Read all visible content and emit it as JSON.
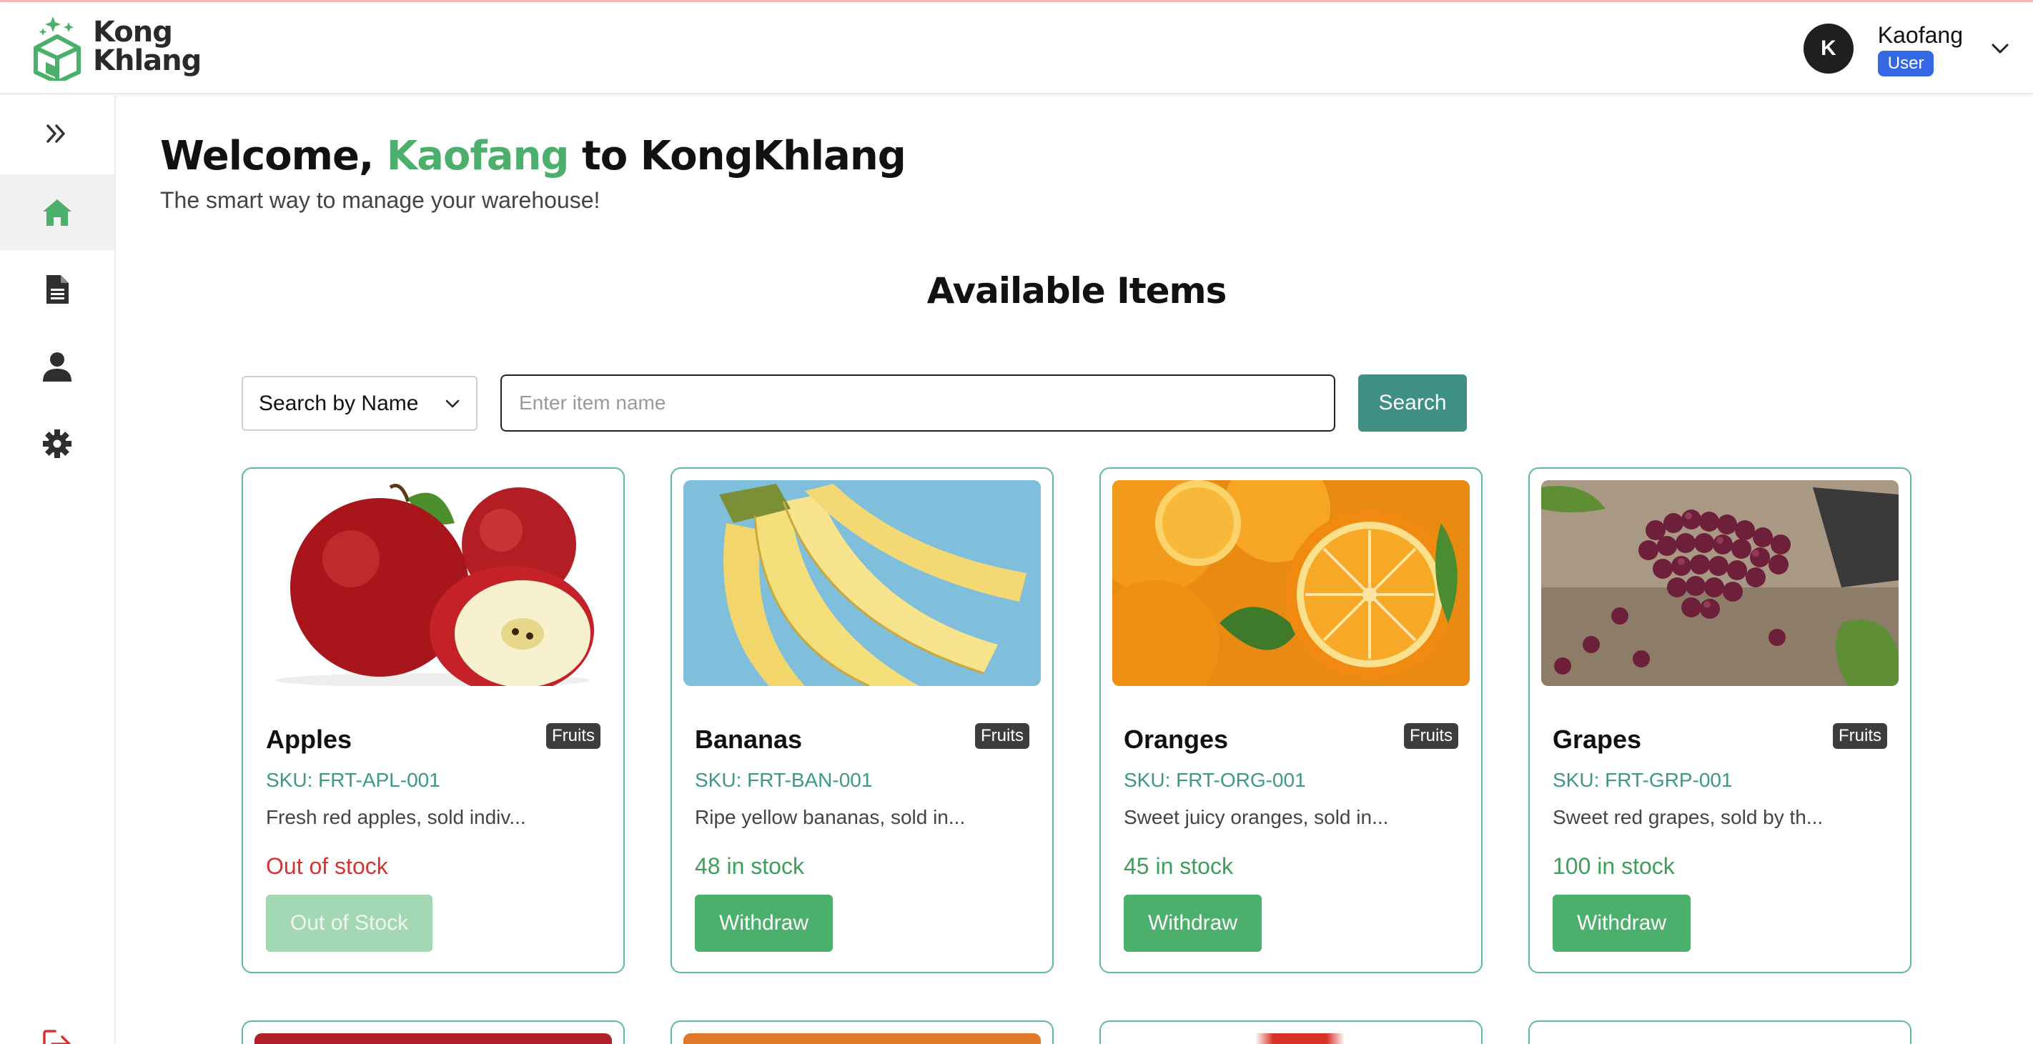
{
  "app": {
    "brand_line1": "Kong",
    "brand_line2": "Khlang"
  },
  "user": {
    "initial": "K",
    "name": "Kaofang",
    "role": "User"
  },
  "welcome": {
    "prefix": "Welcome,",
    "name": "Kaofang",
    "suffix": "to KongKhlang",
    "tagline": "The smart way to manage your warehouse!"
  },
  "section_title": "Available Items",
  "search": {
    "mode": "Search by Name",
    "placeholder": "Enter item name",
    "button": "Search"
  },
  "items": [
    {
      "name": "Apples",
      "category": "Fruits",
      "sku": "SKU: FRT-APL-001",
      "desc": "Fresh red apples, sold indiv...",
      "stock": "Out of stock",
      "action": "Out of Stock"
    },
    {
      "name": "Bananas",
      "category": "Fruits",
      "sku": "SKU: FRT-BAN-001",
      "desc": "Ripe yellow bananas, sold in...",
      "stock": "48 in stock",
      "action": "Withdraw"
    },
    {
      "name": "Oranges",
      "category": "Fruits",
      "sku": "SKU: FRT-ORG-001",
      "desc": "Sweet juicy oranges, sold in...",
      "stock": "45 in stock",
      "action": "Withdraw"
    },
    {
      "name": "Grapes",
      "category": "Fruits",
      "sku": "SKU: FRT-GRP-001",
      "desc": "Sweet red grapes, sold by th...",
      "stock": "100 in stock",
      "action": "Withdraw"
    }
  ],
  "colors": {
    "accent_green": "#4caf6b",
    "teal": "#3f9084",
    "card_border": "#5cb8a8",
    "danger": "#d63333",
    "role_badge": "#3568e4"
  },
  "icons": {
    "sidebar": [
      "expand-icon",
      "home-icon",
      "document-icon",
      "user-icon",
      "settings-icon",
      "logout-icon"
    ]
  }
}
